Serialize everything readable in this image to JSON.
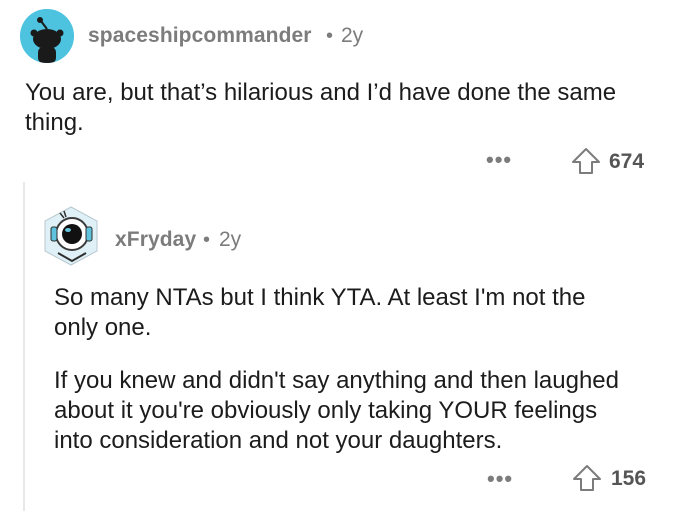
{
  "top_comment": {
    "username": "spaceshipcommander",
    "separator": "•",
    "age": "2y",
    "body_line1": "You are, but that’s hilarious and I’d have done the same",
    "body_line2": "thing.",
    "more_label": "•••",
    "score": "674"
  },
  "reply_comment": {
    "username": "xFryday",
    "separator": "•",
    "age": "2y",
    "para1_line1": "So many NTAs but I think YTA. At least I'm not the",
    "para1_line2": "only one.",
    "para2_line1": "If you knew and didn't say anything and then laughed",
    "para2_line2": "about it you're obviously only taking YOUR feelings",
    "para2_line3": "into consideration and not your daughters.",
    "more_label": "•••",
    "score": "156"
  },
  "colors": {
    "avatar_bg": "#4ec3e0",
    "meta_gray": "#7c7c7c",
    "text_dark": "#1c1c1c",
    "thread_line": "#e8e8e8"
  },
  "icons": {
    "top_avatar": "snoo-avatar-icon",
    "reply_avatar": "astronaut-avatar-icon",
    "upvote": "upvote-arrow-icon",
    "more": "more-options-icon"
  }
}
